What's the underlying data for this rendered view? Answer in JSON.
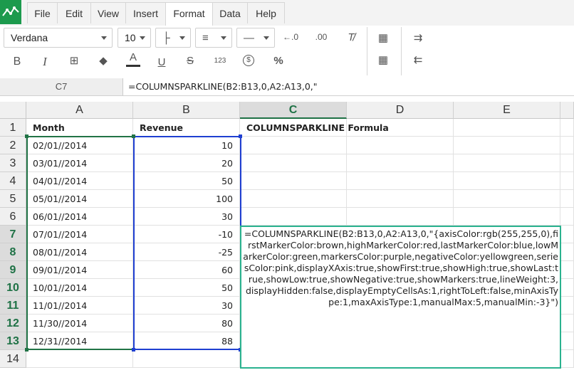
{
  "menu": {
    "tabs": [
      {
        "label": "File"
      },
      {
        "label": "Edit"
      },
      {
        "label": "View"
      },
      {
        "label": "Insert"
      },
      {
        "label": "Format"
      },
      {
        "label": "Data"
      },
      {
        "label": "Help"
      }
    ],
    "active": "Format"
  },
  "toolbar": {
    "font_family": "Verdana",
    "font_size": "10",
    "buttons_row1": [
      "borders-icon",
      "align-icon",
      "valign-icon",
      "decrease-decimal-icon",
      "increase-decimal-icon",
      "clear-format-icon",
      "merge-cells-icon",
      "indent-icon"
    ],
    "bold": "B",
    "italic": "I",
    "font_color_letter": "A",
    "underline": "U",
    "strikethrough": "S",
    "number_format": "123",
    "currency_symbol": "$",
    "percent_symbol": "%"
  },
  "formula_bar": {
    "name_box": "C7",
    "formula": "=COLUMNSPARKLINE(B2:B13,0,A2:A13,0,\""
  },
  "grid": {
    "columns": [
      "A",
      "B",
      "C",
      "D",
      "E"
    ],
    "rows": [
      "1",
      "2",
      "3",
      "4",
      "5",
      "6",
      "7",
      "8",
      "9",
      "10",
      "11",
      "12",
      "13",
      "14"
    ],
    "selected_column": "C",
    "selected_rows": [
      "7",
      "8",
      "9",
      "10",
      "11",
      "12",
      "13"
    ],
    "header": {
      "a": "Month",
      "b": "Revenue",
      "c": "COLUMNSPARKLINE Formula"
    },
    "data": [
      {
        "month": "02/01//2014",
        "revenue": "10"
      },
      {
        "month": "03/01//2014",
        "revenue": "20"
      },
      {
        "month": "04/01//2014",
        "revenue": "50"
      },
      {
        "month": "05/01//2014",
        "revenue": "100"
      },
      {
        "month": "06/01//2014",
        "revenue": "30"
      },
      {
        "month": "07/01//2014",
        "revenue": "-10"
      },
      {
        "month": "08/01//2014",
        "revenue": "-25"
      },
      {
        "month": "09/01//2014",
        "revenue": "60"
      },
      {
        "month": "10/01//2014",
        "revenue": "50"
      },
      {
        "month": "11/01//2014",
        "revenue": "30"
      },
      {
        "month": "11/30//2014",
        "revenue": "80"
      },
      {
        "month": "12/31//2014",
        "revenue": "88"
      }
    ]
  },
  "editor": {
    "text": "=COLUMNSPARKLINE(B2:B13,0,A2:A13,0,\"{axisColor:rgb(255,255,0),firstMarkerColor:brown,highMarkerColor:red,lastMarkerColor:blue,lowMarkerColor:green,markersColor:purple,negativeColor:yellowgreen,seriesColor:pink,displayXAxis:true,showFirst:true,showHigh:true,showLast:true,showLow:true,showNegative:true,showMarkers:true,lineWeight:3,displayHidden:false,displayEmptyCellsAs:1,rightToLeft:false,minAxisType:1,maxAxisType:1,manualMax:5,manualMin:-3}\")"
  },
  "colors": {
    "accent": "#217346",
    "range_a": "#217346",
    "range_b": "#1f3fd1",
    "editor_border": "#2ab28f"
  }
}
